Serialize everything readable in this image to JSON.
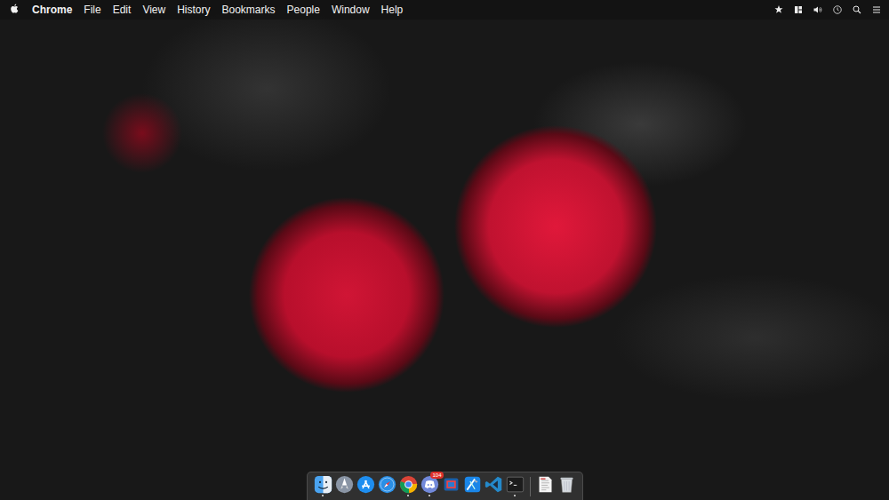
{
  "menu_bar": {
    "app": "Chrome",
    "items": [
      "File",
      "Edit",
      "View",
      "History",
      "Bookmarks",
      "People",
      "Window",
      "Help"
    ]
  },
  "dock": {
    "apps": [
      {
        "kind": "finder",
        "running": true
      },
      {
        "kind": "launchpad",
        "running": false
      },
      {
        "kind": "appstore",
        "running": false
      },
      {
        "kind": "safari",
        "running": false
      },
      {
        "kind": "chrome",
        "running": true
      },
      {
        "kind": "discord",
        "running": true,
        "badge": "104"
      },
      {
        "kind": "virtualbox",
        "running": false
      },
      {
        "kind": "xcode",
        "running": false
      },
      {
        "kind": "vscode",
        "running": false
      },
      {
        "kind": "terminal",
        "running": true
      }
    ],
    "others": [
      {
        "kind": "document",
        "running": false
      },
      {
        "kind": "trash",
        "running": false
      }
    ]
  }
}
